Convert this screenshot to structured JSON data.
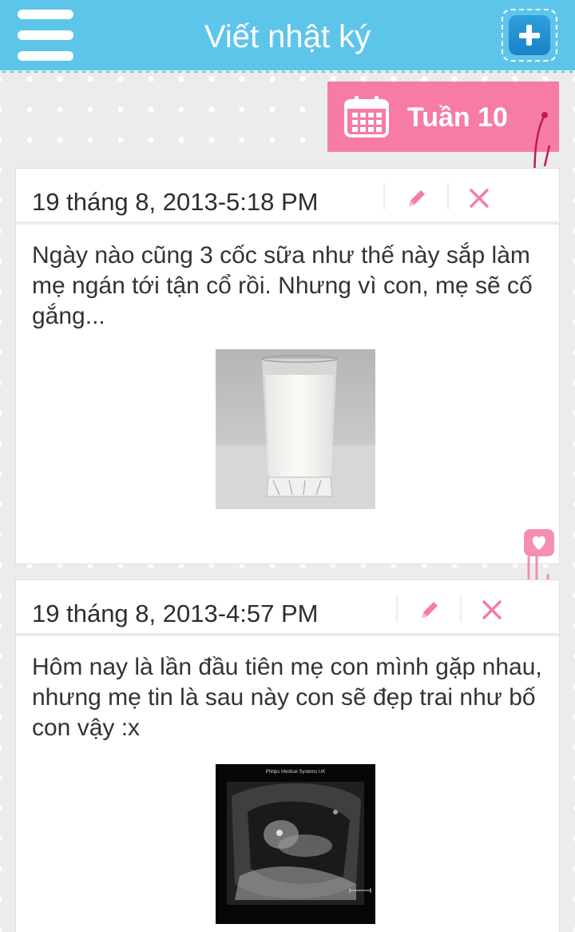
{
  "header": {
    "title": "Viết nhật ký",
    "menu_icon": "hamburger-menu-icon",
    "add_icon": "plus-icon"
  },
  "week_tag": {
    "label": "Tuần 10",
    "icon": "calendar-icon"
  },
  "colors": {
    "header": "#5ec5ea",
    "accent_pink": "#f67ca4",
    "add_button": "#1b82c7",
    "background": "#ececec"
  },
  "entries": [
    {
      "date": "19 tháng 8, 2013-5:18 PM",
      "text": "Ngày nào cũng 3 cốc sữa như thế này sắp làm mẹ ngán tới tận cổ rồi. Nhưng vì con, mẹ sẽ cố gắng...",
      "image": "glass-of-milk-photo",
      "edit_icon": "pencil-icon",
      "delete_icon": "close-icon"
    },
    {
      "date": "19 tháng 8, 2013-4:57 PM",
      "text": "Hôm nay là lần đầu tiên mẹ con mình gặp nhau, nhưng mẹ tin là sau này con sẽ đẹp trai như bố con vậy :x",
      "image": "ultrasound-scan-photo",
      "image_caption": "Philips Medical Systems UK",
      "edit_icon": "pencil-icon",
      "delete_icon": "close-icon"
    }
  ]
}
